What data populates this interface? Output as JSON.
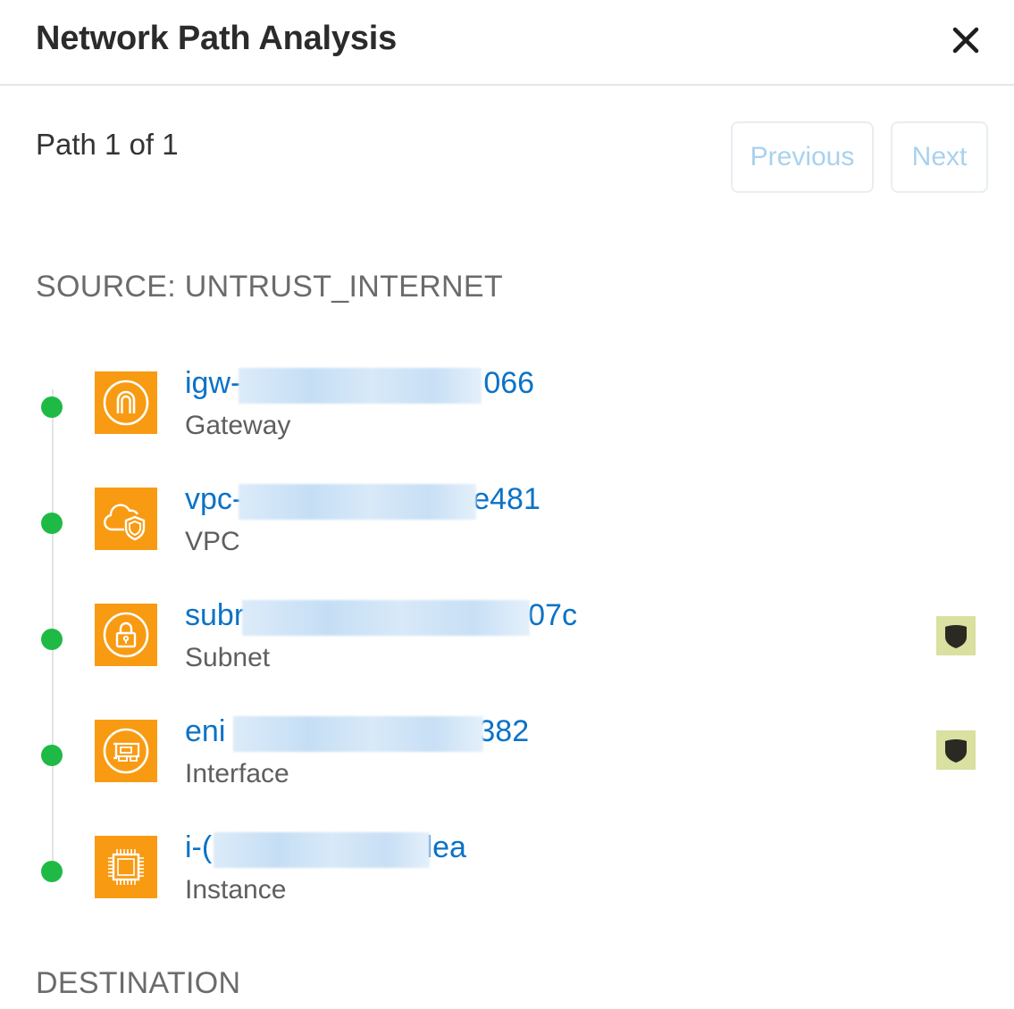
{
  "header": {
    "title": "Network Path Analysis",
    "close_icon": "close-icon"
  },
  "pagination": {
    "label": "Path 1 of 1",
    "previous_label": "Previous",
    "next_label": "Next",
    "disabled_color": "#a8d2ee"
  },
  "source": {
    "label": "SOURCE: UNTRUST_INTERNET"
  },
  "hops": [
    {
      "id_prefix": "igw-",
      "id_suffix": "066",
      "type": "Gateway",
      "icon": "gateway-icon",
      "has_security_badge": false
    },
    {
      "id_prefix": "vpc-",
      "id_suffix": "e481",
      "type": "VPC",
      "icon": "vpc-cloud-shield-icon",
      "has_security_badge": false
    },
    {
      "id_prefix": "subr",
      "id_suffix": "07c",
      "type": "Subnet",
      "icon": "subnet-lock-icon",
      "has_security_badge": true
    },
    {
      "id_prefix": "eni",
      "id_suffix": "382",
      "type": "Interface",
      "icon": "network-interface-icon",
      "has_security_badge": true
    },
    {
      "id_prefix": "i-(",
      "id_suffix": "dea",
      "type": "Instance",
      "icon": "instance-chip-icon",
      "has_security_badge": false
    }
  ],
  "destination": {
    "label": "DESTINATION"
  },
  "colors": {
    "accent_orange": "#f89b12",
    "status_green": "#1fba45",
    "link_blue": "#0b72c7",
    "badge_bg": "#d9e0a0"
  }
}
